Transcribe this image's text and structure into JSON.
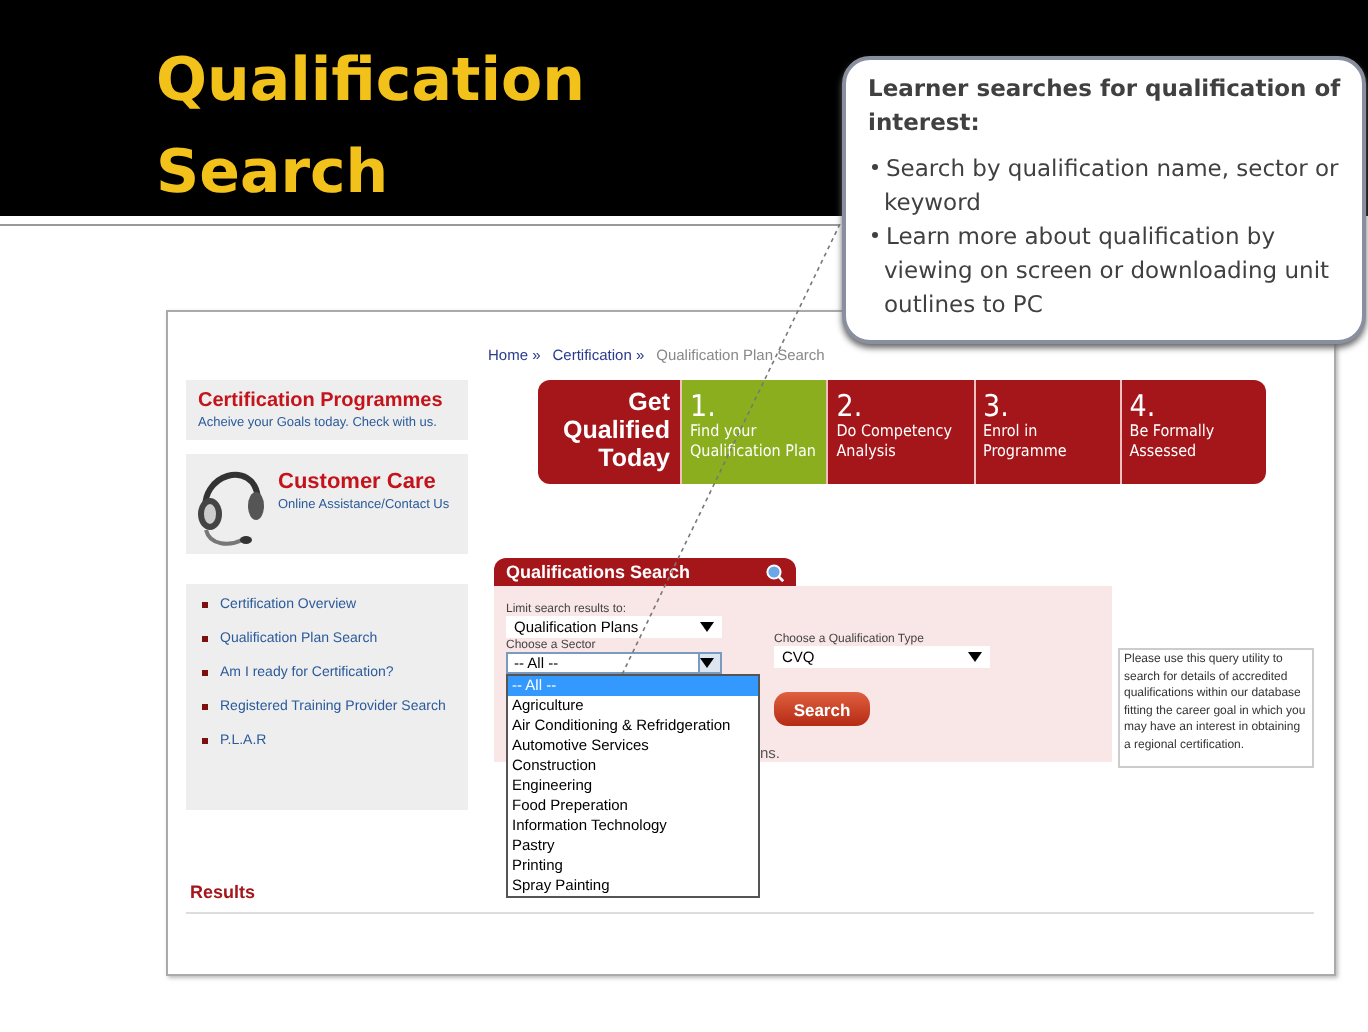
{
  "slide": {
    "title": "Qualification Search"
  },
  "callout": {
    "heading": "Learner searches for qualification of interest:",
    "bullets": [
      "Search by qualification name, sector or keyword",
      "Learn more about qualification by viewing on screen or downloading unit outlines to PC"
    ]
  },
  "breadcrumb": [
    {
      "label": "Home »",
      "current": false
    },
    {
      "label": "Certification »",
      "current": false
    },
    {
      "label": "Qualification Plan Search",
      "current": true
    }
  ],
  "sidebar": {
    "promo": {
      "title": "Certification Programmes",
      "subtitle": "Acheive your Goals today. Check with us."
    },
    "customer_care": {
      "title": "Customer Care",
      "link": "Online Assistance/Contact Us"
    },
    "nav_links": [
      "Certification Overview",
      "Qualification Plan Search",
      "Am I ready for Certification?",
      "Registered Training Provider Search",
      "P.L.A.R"
    ]
  },
  "steps_banner": {
    "intro": "Get Qualified Today",
    "steps": [
      {
        "number": "1.",
        "label": "Find your Qualification Plan",
        "selected": true
      },
      {
        "number": "2.",
        "label": "Do Competency Analysis",
        "selected": false
      },
      {
        "number": "3.",
        "label": "Enrol in Programme",
        "selected": false
      },
      {
        "number": "4.",
        "label": "Be Formally Assessed",
        "selected": false
      }
    ]
  },
  "search": {
    "title": "Qualifications Search",
    "limit_label": "Limit search results to:",
    "limit_value": "Qualification Plans",
    "sector_label": "Choose a Sector",
    "sector_value": "-- All --",
    "sector_options": [
      {
        "label": "-- All --",
        "selected": true
      },
      {
        "label": "Agriculture",
        "selected": false
      },
      {
        "label": "Air Conditioning & Refridgeration",
        "selected": false
      },
      {
        "label": "Automotive Services",
        "selected": false
      },
      {
        "label": "Construction",
        "selected": false
      },
      {
        "label": "Engineering",
        "selected": false
      },
      {
        "label": "Food Preperation",
        "selected": false
      },
      {
        "label": "Information Technology",
        "selected": false
      },
      {
        "label": "Pastry",
        "selected": false
      },
      {
        "label": "Printing",
        "selected": false
      },
      {
        "label": "Spray Painting",
        "selected": false
      }
    ],
    "type_label": "Choose a Qualification Type",
    "type_value": "CVQ",
    "button": "Search",
    "hint_fragment": "ns."
  },
  "info_text": "Please use this query utility to search for details of accredited qualifications within our database fitting the career goal in which you may have an interest in obtaining a regional certification.",
  "results_heading": "Results"
}
